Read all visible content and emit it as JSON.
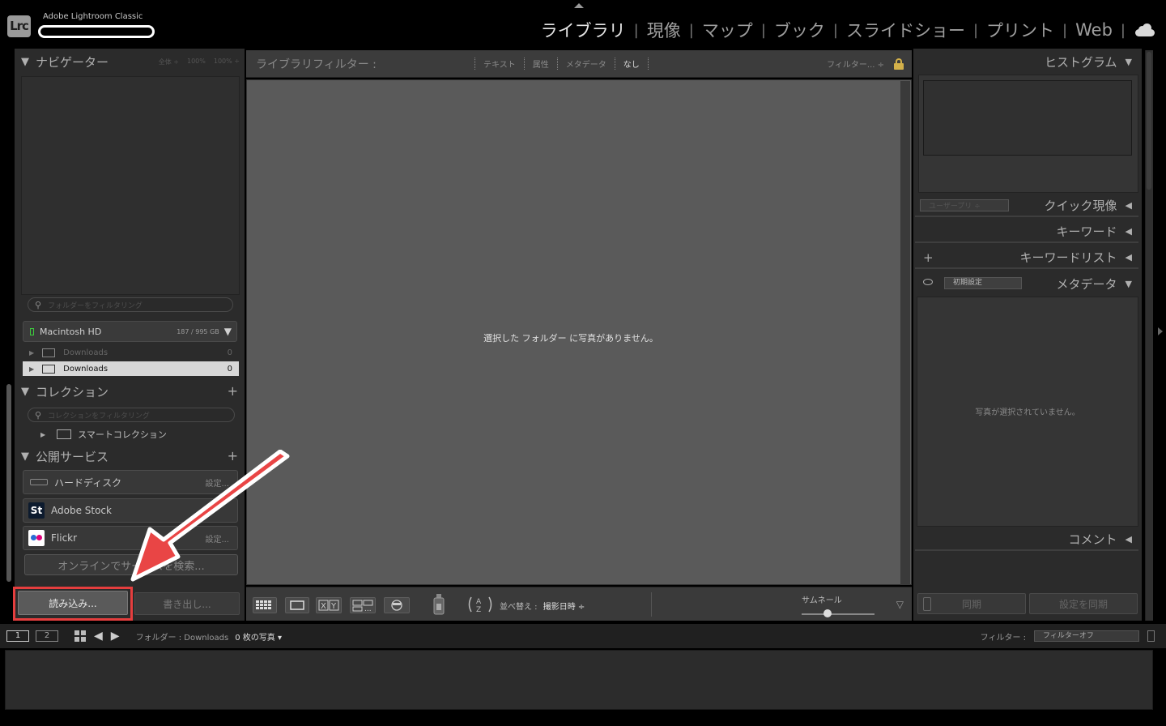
{
  "app": {
    "logo_text": "Lrc",
    "name": "Adobe Lightroom Classic"
  },
  "modules": {
    "items": [
      "ライブラリ",
      "現像",
      "マップ",
      "ブック",
      "スライドショー",
      "プリント",
      "Web"
    ],
    "active": "ライブラリ"
  },
  "navigator": {
    "title": "ナビゲーター",
    "zoom_options": [
      "全体 ÷",
      "100%",
      "100% ÷"
    ]
  },
  "folders": {
    "search_placeholder": "フォルダーをフィルタリング",
    "volume_name": "Macintosh HD",
    "volume_size": "187 / 995 GB",
    "items": [
      {
        "name": "Downloads",
        "count": "0"
      },
      {
        "name": "Downloads",
        "count": "0"
      }
    ]
  },
  "collections": {
    "title": "コレクション",
    "search_placeholder": "コレクションをフィルタリング",
    "smart_collection": "スマートコレクション"
  },
  "publish_services": {
    "title": "公開サービス",
    "items": [
      {
        "name": "ハードディスク",
        "setup": "設定..."
      },
      {
        "name": "Adobe Stock",
        "setup": ""
      },
      {
        "name": "Flickr",
        "setup": "設定..."
      }
    ],
    "online_button": "オンラインでサービスを検索..."
  },
  "left_bottom": {
    "import_label": "読み込み...",
    "export_label": "書き出し..."
  },
  "library_filter": {
    "title": "ライブラリフィルター :",
    "tabs": [
      "テキスト",
      "属性",
      "メタデータ",
      "なし"
    ],
    "active_tab": "なし",
    "preset": "フィルター... ÷"
  },
  "grid": {
    "empty_message": "選択した フォルダー に写真がありません。"
  },
  "toolbar": {
    "sort_prefix": "並べ替え :",
    "sort_value": "撮影日時 ÷",
    "thumbnail_label": "サムネール",
    "thumbnail_size": 0.35,
    "menu_glyph": "▽"
  },
  "right_panel": {
    "histogram": "ヒストグラム",
    "quick_develop": "クイック現像",
    "quick_develop_preset": "ユーザープリ ÷",
    "keywording": "キーワード",
    "keyword_list": "キーワードリスト",
    "metadata": "メタデータ",
    "metadata_preset": "初期設定",
    "metadata_empty": "写真が選択されていません。",
    "comments": "コメント",
    "sync_label": "同期",
    "sync_settings_label": "設定を同期"
  },
  "filmstrip_bar": {
    "screen_1": "1",
    "screen_2": "2",
    "folder_label": "フォルダー : Downloads",
    "photo_count": "0 枚の写真 ▾",
    "filter_label": "フィルター :",
    "filter_value": "フィルターオフ"
  },
  "colors": {
    "highlight": "#e53e3e",
    "arrow": "#e94545",
    "volume_led": "#3dcc3d",
    "lock": "#d4b14a"
  }
}
